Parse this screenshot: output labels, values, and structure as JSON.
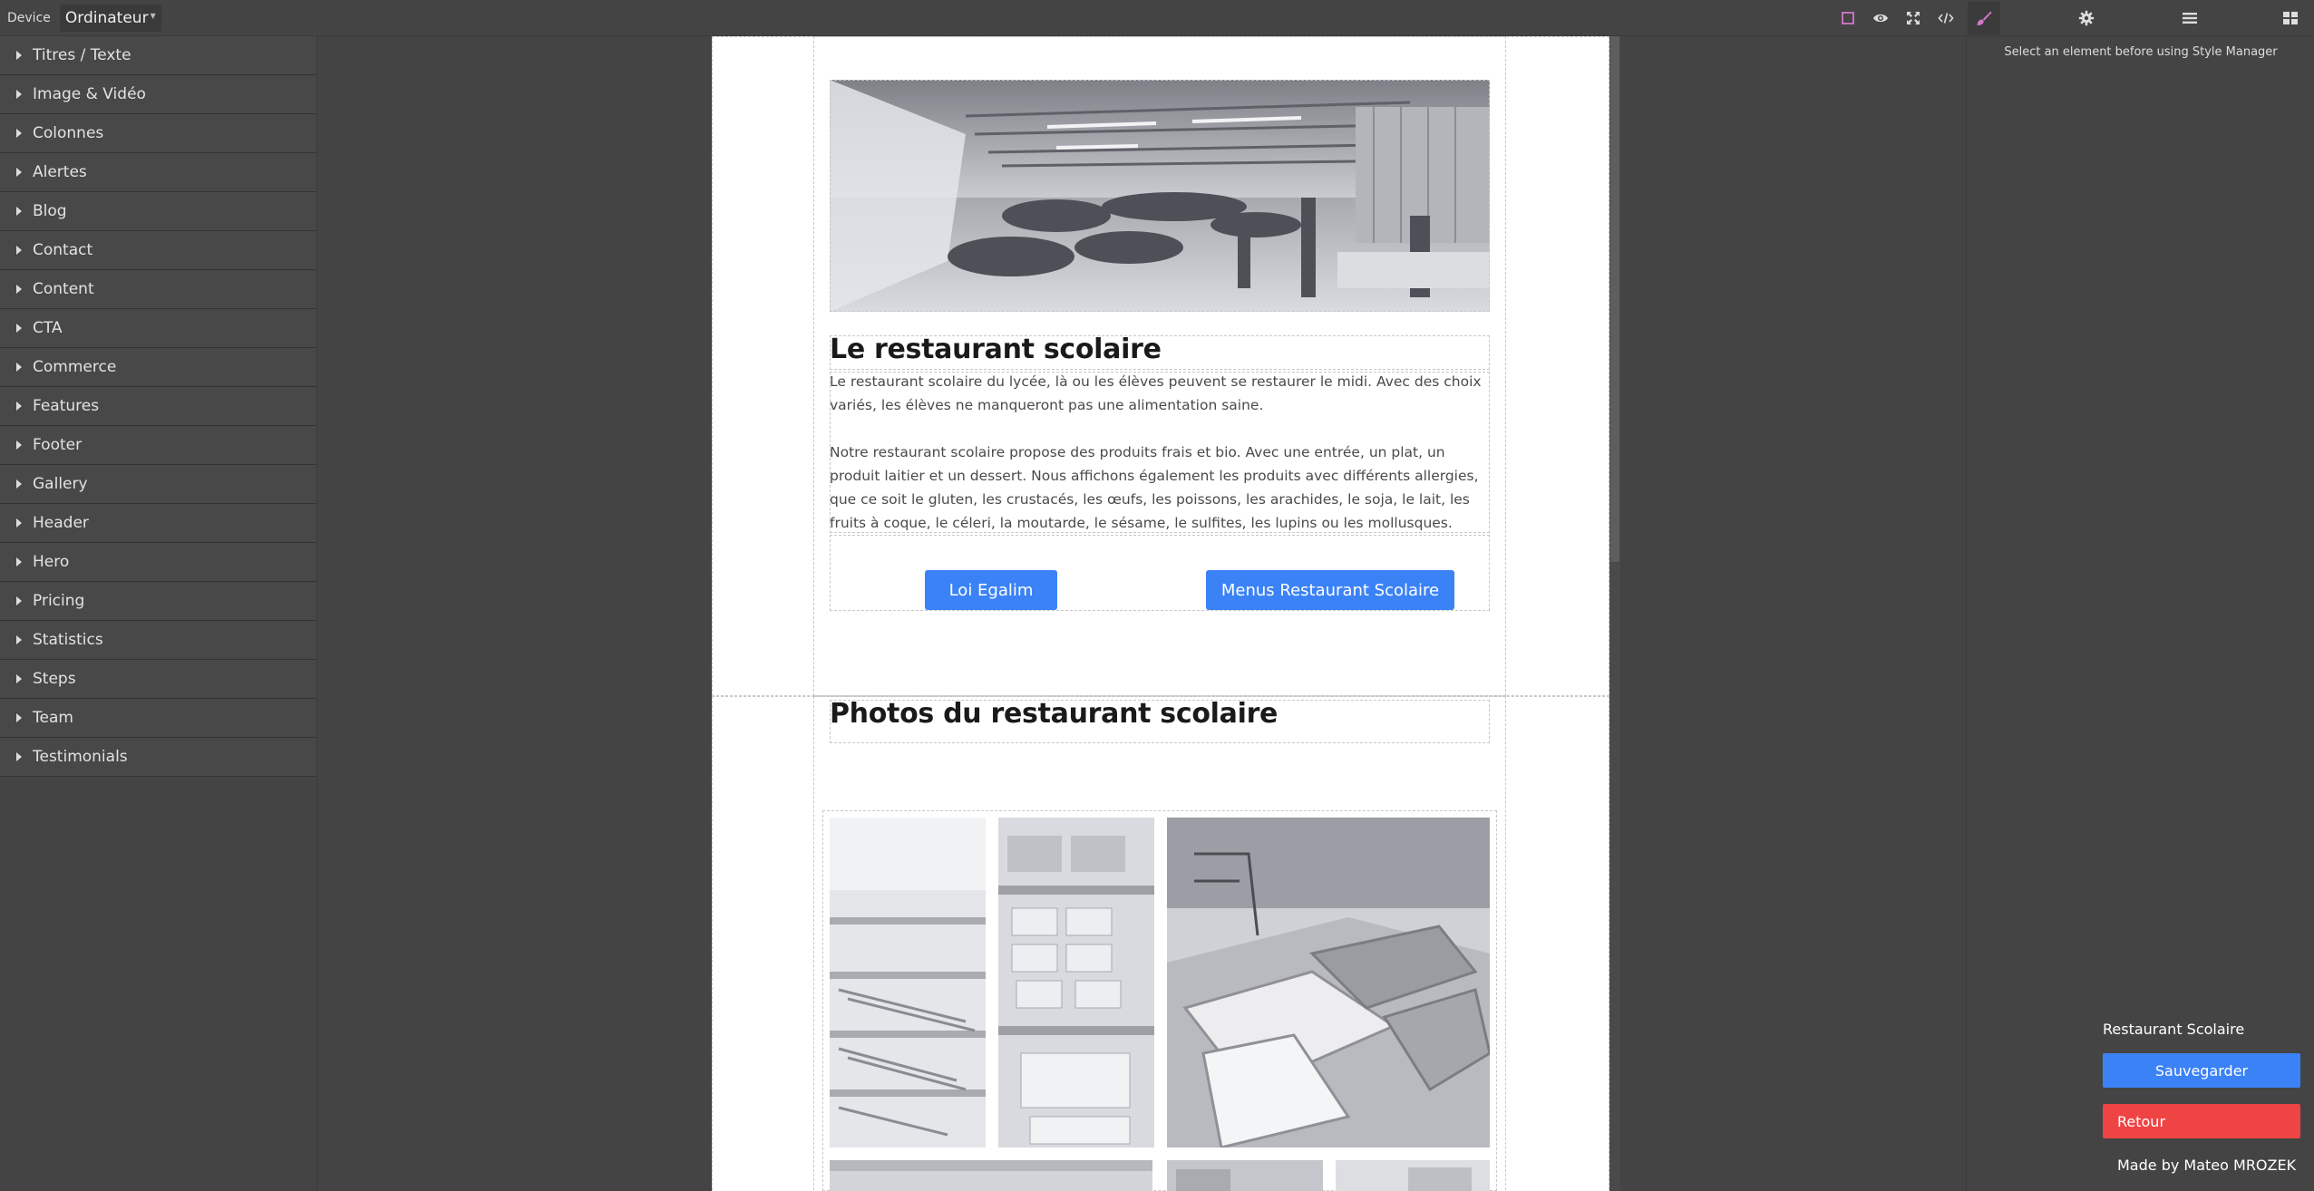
{
  "device": {
    "label": "Device",
    "selected": "Ordinateur"
  },
  "toolbar": {
    "icons": [
      "square-outline-icon",
      "eye-icon",
      "fullscreen-icon",
      "code-icon",
      "paintbrush-icon",
      "gear-icon",
      "menu-lines-icon",
      "blocks-grid-icon"
    ],
    "active_color": "#d278c9"
  },
  "blocks": {
    "categories": [
      "Titres / Texte",
      "Image & Vidéo",
      "Colonnes",
      "Alertes",
      "Blog",
      "Contact",
      "Content",
      "CTA",
      "Commerce",
      "Features",
      "Footer",
      "Gallery",
      "Header",
      "Hero",
      "Pricing",
      "Statistics",
      "Steps",
      "Team",
      "Testimonials"
    ]
  },
  "page": {
    "section1": {
      "title": "Le restaurant scolaire",
      "paragraph1": "Le restaurant scolaire du lycée, là ou les élèves peuvent se restaurer le midi. Avec des choix variés, les élèves ne manqueront pas une alimentation saine.",
      "paragraph2": "Notre restaurant scolaire propose des produits frais et bio. Avec une entrée, un plat, un produit laitier et un dessert. Nous affichons également les produits avec différents allergies, que ce soit le gluten, les crustacés, les œufs, les poissons, les arachides, le soja, le lait, les fruits à coque, le céleri, la moutarde, le sésame, le sulfites, les lupins ou les mollusques.",
      "button1": "Loi Egalim",
      "button2": "Menus Restaurant Scolaire"
    },
    "section2": {
      "title": "Photos du restaurant scolaire"
    }
  },
  "style_manager": {
    "message": "Select an element before using Style Manager"
  },
  "project": {
    "name": "Restaurant Scolaire",
    "save_label": "Sauvegarder",
    "back_label": "Retour",
    "credit": "Made by Mateo MROZEK"
  },
  "colors": {
    "primary": "#3b82f6",
    "danger": "#ef4444",
    "panel": "#444444"
  }
}
